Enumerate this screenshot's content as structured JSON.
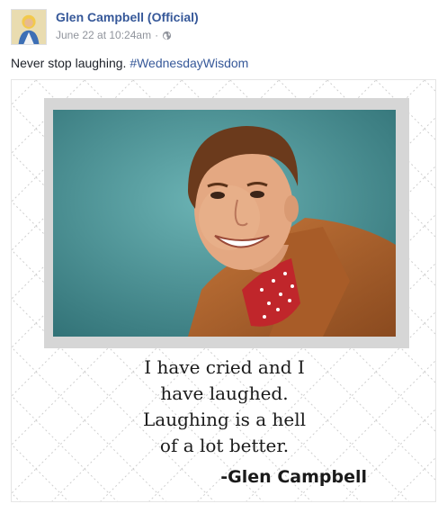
{
  "post": {
    "author_name": "Glen Campbell (Official)",
    "timestamp": "June 22 at 10:24am",
    "separator": "·",
    "privacy_icon": "globe-icon",
    "text": "Never stop laughing. ",
    "hashtag": "#WednesdayWisdom"
  },
  "image": {
    "quote_lines": [
      "I have cried and I",
      "have laughed.",
      "Laughing is a hell",
      "of a lot better."
    ],
    "attribution": "-Glen Campbell"
  },
  "colors": {
    "link": "#365899",
    "meta": "#90949c",
    "text": "#1d2129"
  }
}
